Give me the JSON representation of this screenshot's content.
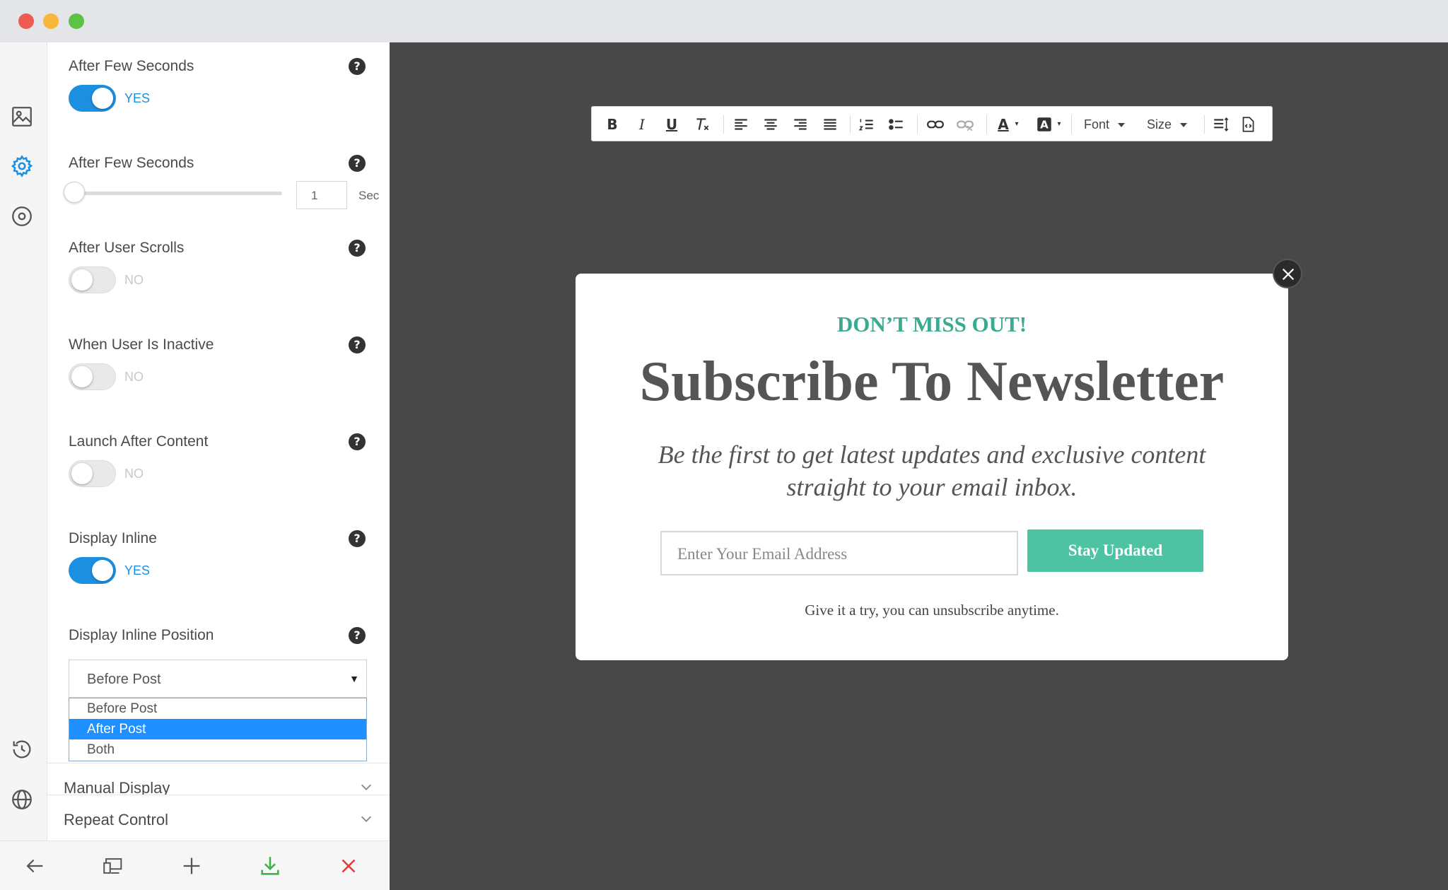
{
  "settings": {
    "after_few_seconds_toggle": {
      "label": "After Few Seconds",
      "state": "YES",
      "help": "?"
    },
    "after_few_seconds_slider": {
      "label": "After Few Seconds",
      "value": "1",
      "unit": "Sec",
      "help": "?"
    },
    "after_user_scrolls": {
      "label": "After User Scrolls",
      "state": "NO",
      "help": "?"
    },
    "when_user_inactive": {
      "label": "When User Is Inactive",
      "state": "NO",
      "help": "?"
    },
    "launch_after_content": {
      "label": "Launch After Content",
      "state": "NO",
      "help": "?"
    },
    "display_inline": {
      "label": "Display Inline",
      "state": "YES",
      "help": "?"
    },
    "display_inline_position": {
      "label": "Display Inline Position",
      "help": "?",
      "selected": "Before Post",
      "options": [
        "Before Post",
        "After Post",
        "Both"
      ],
      "highlighted": "After Post"
    }
  },
  "sections": {
    "manual_display": "Manual Display",
    "repeat_control": "Repeat Control"
  },
  "rail_icons": [
    "image-icon",
    "gear-icon",
    "target-icon",
    "history-icon",
    "globe-icon"
  ],
  "bottom_bar_icons": [
    "back-arrow-icon",
    "devices-icon",
    "plus-icon",
    "download-icon",
    "close-icon"
  ],
  "editor_toolbar": {
    "buttons": [
      "bold",
      "italic",
      "underline",
      "clear-format",
      "align-left",
      "align-center",
      "align-right",
      "justify",
      "numbered-list",
      "bulleted-list",
      "link",
      "unlink",
      "text-color",
      "background-color"
    ],
    "bold": "B",
    "italic": "I",
    "underline": "U",
    "text_color": "A",
    "font": "Font",
    "size": "Size"
  },
  "popup": {
    "kicker": "DON’T MISS OUT!",
    "headline": "Subscribe To Newsletter",
    "subtext": "Be the first to get latest updates and exclusive content straight to your email inbox.",
    "email_placeholder": "Enter Your Email Address",
    "cta": "Stay Updated",
    "fineprint": "Give it a try, you can unsubscribe anytime."
  },
  "colors": {
    "accent_blue": "#1d8fe0",
    "popup_teal": "#3aaa91",
    "cta_green": "#4ec3a4",
    "canvas": "#484848",
    "download_green": "#3cb34a",
    "delete_red": "#e53935"
  }
}
